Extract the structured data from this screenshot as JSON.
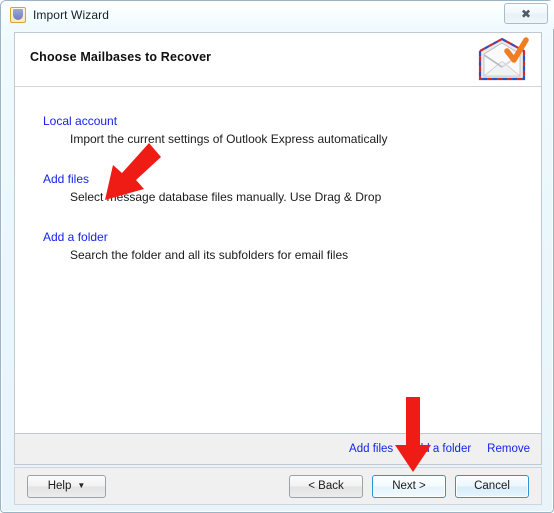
{
  "window": {
    "title": "Import Wizard",
    "title_icon": "outlook-express-icon",
    "close_button": {
      "label": "✖",
      "name": "close-icon"
    }
  },
  "dialog": {
    "header_title": "Choose Mailbases to Recover",
    "header_icon": "envelope-check-icon"
  },
  "options": [
    {
      "link": "Local account",
      "description": "Import the current settings of Outlook Express automatically"
    },
    {
      "link": "Add files",
      "description": "Select message database files manually. Use Drag & Drop"
    },
    {
      "link": "Add a folder",
      "description": "Search the folder and all its subfolders for email files"
    }
  ],
  "linkbar": [
    {
      "label": "Add files"
    },
    {
      "label": "Add a folder"
    },
    {
      "label": "Remove"
    }
  ],
  "buttons": {
    "help": "Help",
    "help_caret": "▼",
    "back": "< Back",
    "next": "Next >",
    "cancel": "Cancel"
  },
  "annotations": [
    {
      "name": "arrow-pointing-to-add-a-folder",
      "color": "#ee1c15",
      "direction": "down-left"
    },
    {
      "name": "arrow-pointing-to-next-button",
      "color": "#ee1c15",
      "direction": "down"
    }
  ],
  "colors": {
    "link": "#1524e8",
    "accent_focus": "#2e95d3",
    "annotation_red": "#ee1c15",
    "panel_bg": "#ffffff",
    "chrome_bg": "#f0f0f0"
  }
}
